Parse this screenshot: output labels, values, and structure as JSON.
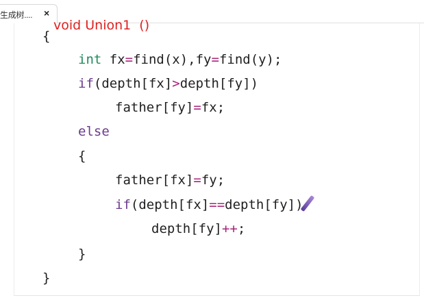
{
  "tab": {
    "label": "生成树....",
    "close": "×"
  },
  "annotation": "void Union1  ()",
  "code": {
    "l1": "{",
    "l2": {
      "type": "int",
      "rest": " fx",
      "eq1": "=",
      "call1": "find(x),fy",
      "eq2": "=",
      "call2": "find(y);"
    },
    "l3": {
      "kw": "if",
      "a": "(depth[fx]",
      "op": ">",
      "b": "depth[fy])"
    },
    "l4": {
      "a": "father[fy]",
      "op": "=",
      "b": "fx;"
    },
    "l5": {
      "kw": "else"
    },
    "l6": "{",
    "l7": {
      "a": "father[fx]",
      "op": "=",
      "b": "fy;"
    },
    "l8": {
      "kw": "if",
      "a": "(depth[fx]",
      "op": "==",
      "b": "depth[fy])"
    },
    "l9": {
      "a": "depth[fy]",
      "op": "++",
      "b": ";"
    },
    "l10": "}",
    "l11": "}"
  },
  "colors": {
    "keyword": "#6a3a8c",
    "type": "#1f8a5a",
    "operator": "#a8227a",
    "annotation": "#e02020"
  }
}
